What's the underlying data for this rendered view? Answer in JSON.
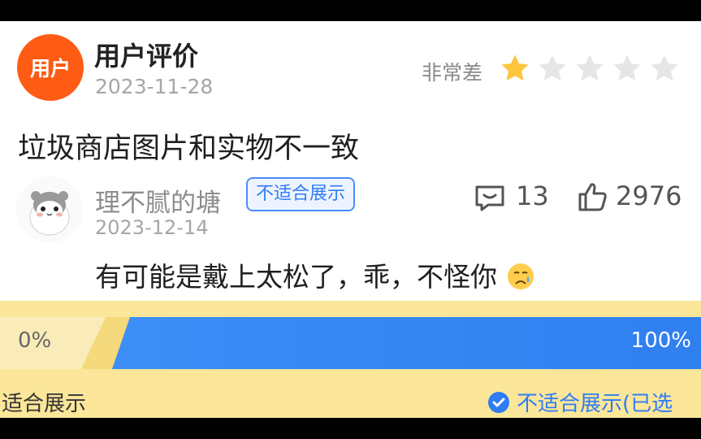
{
  "review": {
    "avatar_text": "用户",
    "name": "用户评价",
    "date": "2023-11-28",
    "rating_label": "非常差",
    "rating": 1,
    "rating_max": 5,
    "text": "垃圾商店图片和实物不一致"
  },
  "reply": {
    "name": "理不腻的塘",
    "tag": "不适合展示",
    "date": "2023-12-14",
    "comments": "13",
    "likes": "2976",
    "text": "有可能是戴上太松了，乖，不怪你"
  },
  "vote": {
    "left_percent": "0%",
    "right_percent": "100%",
    "right_fraction": 1.0,
    "left_option": "适合展示",
    "right_option": "不适合展示(已选"
  },
  "colors": {
    "accent_orange": "#fe5c14",
    "accent_blue": "#2f7cf6",
    "star_active": "#ffc53d",
    "vote_background": "#fbe699"
  }
}
